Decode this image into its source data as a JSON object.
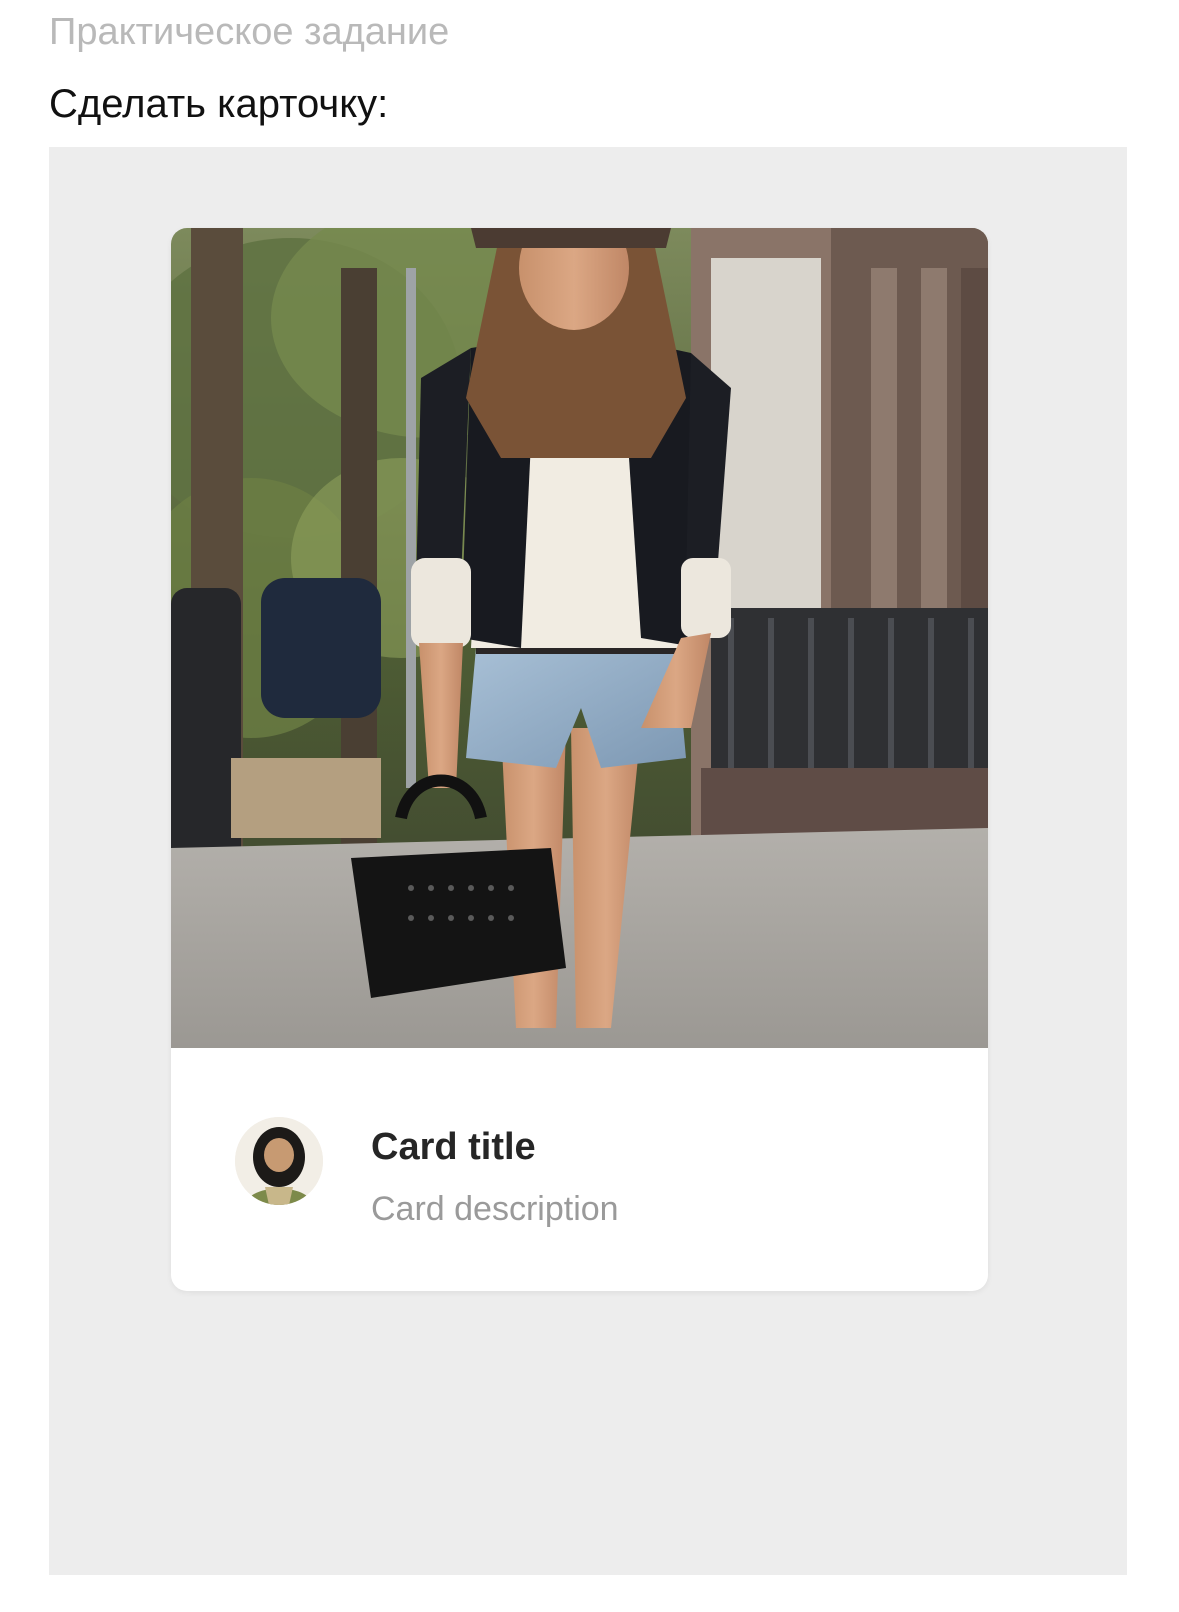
{
  "page": {
    "subtitle": "Практическое задание",
    "heading": "Сделать карточку:"
  },
  "card": {
    "title": "Card title",
    "description": "Card description",
    "cover_alt": "photo",
    "actions": [
      {
        "icon": "gear-icon"
      },
      {
        "icon": "pencil-edit-icon"
      },
      {
        "icon": "more-horizontal-icon"
      }
    ]
  },
  "colors": {
    "stage_background": "#ededed",
    "card_background": "#ffffff",
    "subtitle": "#b9b9b9",
    "heading": "#111111",
    "title": "#262626",
    "description": "#9a9a9a",
    "icon": "#8c8c8c"
  }
}
